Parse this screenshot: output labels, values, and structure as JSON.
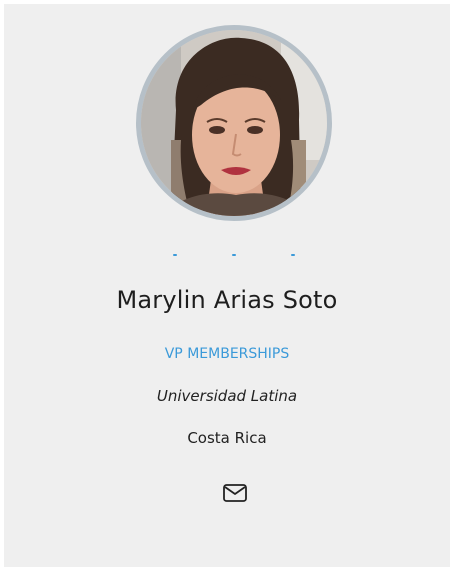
{
  "profile": {
    "name": "Marylin Arias Soto",
    "role": "VP MEMBERSHIPS",
    "organization": "Universidad Latina",
    "country": "Costa Rica"
  },
  "icons": {
    "avatar": "profile-photo",
    "mail": "mail-icon",
    "dots": "social-link-dots"
  },
  "colors": {
    "card_background": "#efefef",
    "accent": "#3b9ad9",
    "avatar_border": "#b6c0c8",
    "text": "#1e1e1e"
  }
}
